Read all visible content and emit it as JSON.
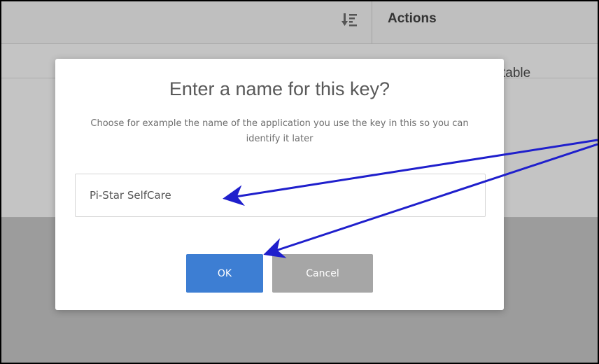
{
  "table": {
    "actions_header": "Actions",
    "row_partial_text": "table"
  },
  "dialog": {
    "title": "Enter a name for this key?",
    "description": "Choose for example the name of the application you use the key in this so you can identify it later",
    "input_value": "Pi-Star SelfCare",
    "ok_label": "OK",
    "cancel_label": "Cancel"
  },
  "icons": {
    "sort": "sort-descending-icon"
  },
  "colors": {
    "ok_button": "#3d7ed3",
    "cancel_button": "#a6a6a6",
    "annotation_arrow": "#1f1fcc",
    "overlay": "#b5b5b5"
  }
}
